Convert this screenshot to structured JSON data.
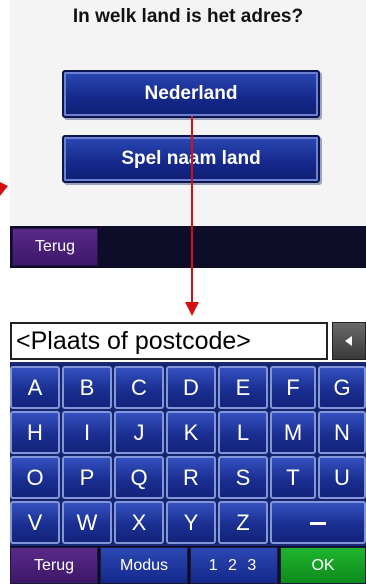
{
  "screen1": {
    "question": "In welk land is het adres?",
    "country_button": "Nederland",
    "spell_button": "Spel naam land",
    "back_button": "Terug"
  },
  "screen2": {
    "input_placeholder": "<Plaats of postcode>",
    "backspace_icon": "triangle-left-icon",
    "keys": [
      "A",
      "B",
      "C",
      "D",
      "E",
      "F",
      "G",
      "H",
      "I",
      "J",
      "K",
      "L",
      "M",
      "N",
      "O",
      "P",
      "Q",
      "R",
      "S",
      "T",
      "U",
      "V",
      "W",
      "X",
      "Y",
      "Z"
    ],
    "space_key_icon": "space-bar-icon",
    "back_button": "Terug",
    "mode_button": "Modus",
    "numeric_button": "1 2 3",
    "ok_button": "OK"
  },
  "colors": {
    "button_blue": "#1b2f92",
    "back_purple": "#3d1768",
    "ok_green": "#0e8a1c",
    "arrow_red": "#d41010"
  }
}
